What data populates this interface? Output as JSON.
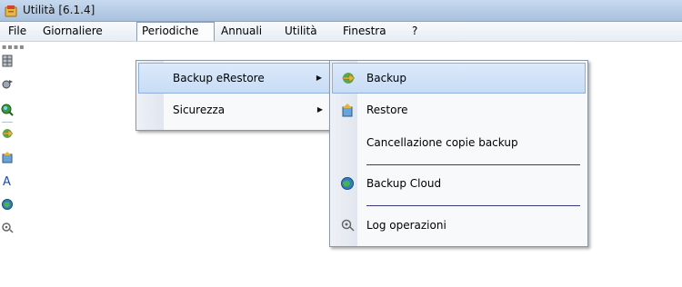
{
  "window": {
    "title": "Utilità [6.1.4]"
  },
  "menubar": {
    "items": [
      {
        "label": "File"
      },
      {
        "label": "Giornaliere"
      },
      {
        "label": "Periodiche"
      },
      {
        "label": "Annuali"
      },
      {
        "label": "Utilità"
      },
      {
        "label": "Finestra"
      },
      {
        "label": "?"
      }
    ],
    "open_item": "Periodiche"
  },
  "periodiche_menu": {
    "items": [
      {
        "label": "Backup eRestore",
        "has_submenu": true
      },
      {
        "label": "Sicurezza",
        "has_submenu": true
      }
    ]
  },
  "backup_submenu": {
    "items": [
      {
        "label": "Backup",
        "icon": "backup-icon"
      },
      {
        "label": "Restore",
        "icon": "restore-icon"
      },
      {
        "label": "Cancellazione copie backup",
        "icon": ""
      },
      {
        "label": "Backup Cloud",
        "icon": "cloud-globe-icon"
      },
      {
        "label": "Log operazioni",
        "icon": "log-icon"
      }
    ],
    "highlighted": "Backup"
  },
  "toolbar": {
    "icons": [
      "grid-icon",
      "gear-icon",
      "globe-search-icon",
      "backup-icon",
      "restore-icon",
      "font-a-icon",
      "cloud-globe-icon",
      "log-icon"
    ]
  },
  "arrow_glyph": "▶"
}
